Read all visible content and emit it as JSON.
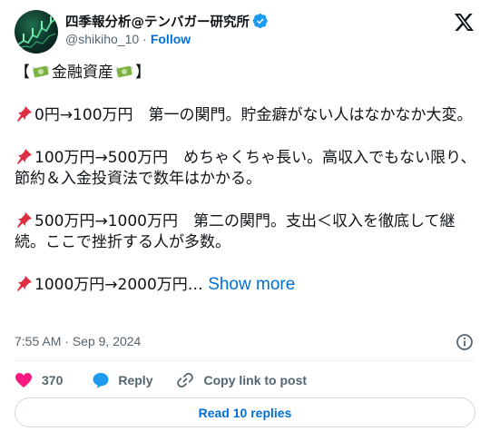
{
  "author": {
    "display_name": "四季報分析@テンバガー研究所",
    "handle": "@shikiho_10",
    "separator": "·",
    "follow_label": "Follow"
  },
  "tweet": {
    "title_open": "【",
    "title_text": "金融資産",
    "title_close": "】",
    "p1": "0円→100万円　第一の関門。貯金癖がない人はなかなか大変。",
    "p2": "100万円→500万円　めちゃくちゃ長い。高収入でもない限り、節約＆入金投資法で数年はかかる。",
    "p3": "500万円→1000万円　第二の関門。支出＜収入を徹底して継続。ここで挫折する人が多数。",
    "p4": "1000万円→2000万円…",
    "show_more": "Show more"
  },
  "meta": {
    "time": "7:55 AM",
    "separator": "·",
    "date": "Sep 9, 2024"
  },
  "actions": {
    "like_count": "370",
    "reply_label": "Reply",
    "copy_label": "Copy link to post"
  },
  "read_replies_label": "Read 10 replies",
  "icons": {
    "verified": "verified-badge-icon",
    "x_logo": "x-logo-icon",
    "info": "info-icon",
    "heart": "heart-icon",
    "reply": "reply-bubble-icon",
    "link": "link-icon",
    "money": "money-with-wings-icon",
    "pushpin": "pushpin-icon"
  },
  "colors": {
    "link_blue": "#006fd6",
    "verified_blue": "#1d9bf0",
    "heart_pink": "#f91880",
    "muted": "#536471"
  }
}
